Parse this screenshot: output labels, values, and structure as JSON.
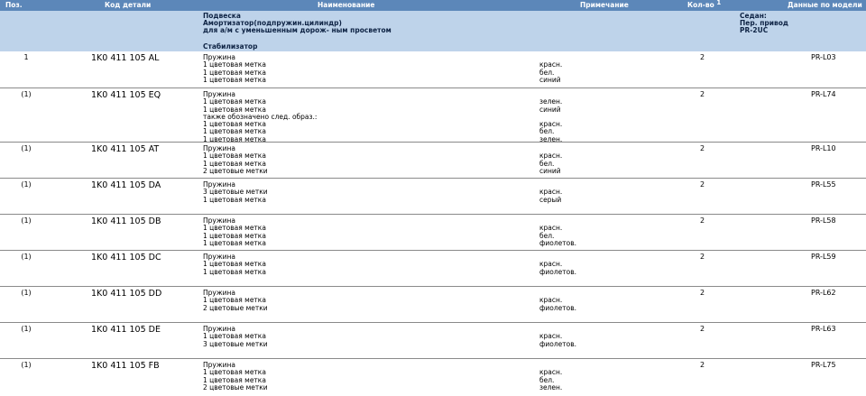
{
  "header": {
    "pos": "Поз.",
    "code": "Код детали",
    "name": "Наименование",
    "note": "Примечание",
    "qty": "Кол-во",
    "qty_sup": "1",
    "model": "Данные по модели"
  },
  "section": {
    "title": "Подвеска\nАмортизатор(подпружин.цилиндр)\nдля а/м с уменьшенным дорож- ным просветом",
    "subtitle": "Стабилизатор",
    "model_info": "Седан:\nПер. привод\nPR-2UC"
  },
  "rows": [
    {
      "pos": "1",
      "code": "1K0 411 105 AL",
      "qty": "2",
      "model": "PR-L03",
      "names": [
        "Пружина",
        "1 цветовая метка",
        "1 цветовая метка",
        "1 цветовая метка"
      ],
      "notes": [
        "",
        "красн.",
        "бел.",
        "синий"
      ]
    },
    {
      "pos": "(1)",
      "code": "1K0 411 105 EQ",
      "qty": "2",
      "model": "PR-L74",
      "names": [
        "Пружина",
        "1 цветовая метка",
        "1 цветовая метка",
        "также обозначено след. образ.:",
        "1 цветовая метка",
        "1 цветовая метка",
        "1 цветовая метка"
      ],
      "notes": [
        "",
        "зелен.",
        "синий",
        "",
        "красн.",
        "бел.",
        "зелен."
      ]
    },
    {
      "pos": "(1)",
      "code": "1K0 411 105 AT",
      "qty": "2",
      "model": "PR-L10",
      "names": [
        "Пружина",
        "1 цветовая метка",
        "1 цветовая метка",
        "2 цветовые метки"
      ],
      "notes": [
        "",
        "красн.",
        "бел.",
        "синий"
      ]
    },
    {
      "pos": "(1)",
      "code": "1K0 411 105 DA",
      "qty": "2",
      "model": "PR-L55",
      "names": [
        "Пружина",
        "3 цветовые метки",
        "1 цветовая метка"
      ],
      "notes": [
        "",
        "красн.",
        "серый"
      ]
    },
    {
      "pos": "(1)",
      "code": "1K0 411 105 DB",
      "qty": "2",
      "model": "PR-L58",
      "names": [
        "Пружина",
        "1 цветовая метка",
        "1 цветовая метка",
        "1 цветовая метка"
      ],
      "notes": [
        "",
        "красн.",
        "бел.",
        "фиолетов."
      ]
    },
    {
      "pos": "(1)",
      "code": "1K0 411 105 DC",
      "qty": "2",
      "model": "PR-L59",
      "names": [
        "Пружина",
        "1 цветовая метка",
        "1 цветовая метка"
      ],
      "notes": [
        "",
        "красн.",
        "фиолетов."
      ]
    },
    {
      "pos": "(1)",
      "code": "1K0 411 105 DD",
      "qty": "2",
      "model": "PR-L62",
      "names": [
        "Пружина",
        "1 цветовая метка",
        "2 цветовые метки"
      ],
      "notes": [
        "",
        "красн.",
        "фиолетов."
      ]
    },
    {
      "pos": "(1)",
      "code": "1K0 411 105 DE",
      "qty": "2",
      "model": "PR-L63",
      "names": [
        "Пружина",
        "1 цветовая метка",
        "3 цветовые метки"
      ],
      "notes": [
        "",
        "красн.",
        "фиолетов."
      ]
    },
    {
      "pos": "(1)",
      "code": "1K0 411 105 FB",
      "qty": "2",
      "model": "PR-L75",
      "names": [
        "Пружина",
        "1 цветовая метка",
        "1 цветовая метка",
        "2 цветовые метки"
      ],
      "notes": [
        "",
        "красн.",
        "бел.",
        "зелен."
      ]
    }
  ]
}
